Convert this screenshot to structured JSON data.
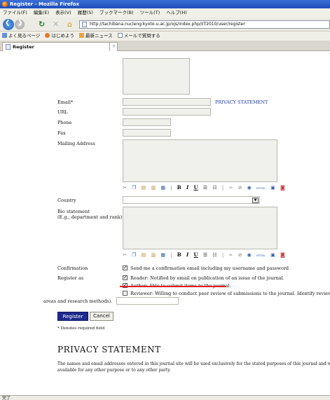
{
  "window": {
    "title": "Register - Mozilla Firefox"
  },
  "menubar": {
    "items": [
      "ファイル(F)",
      "編集(E)",
      "表示(V)",
      "履歴(S)",
      "ブックマーク(B)",
      "ツール(T)",
      "ヘルプ(H)"
    ]
  },
  "navbar": {
    "url": "http://tachibana.nucleng.kyoto-u.ac.jp/ojs/index.php/IIT2010/user/register"
  },
  "bookmarks": {
    "items": [
      "よく見るページ",
      "はじめよう",
      "最新ニュース",
      "メールで質問する"
    ]
  },
  "tabs": [
    {
      "label": "Register"
    }
  ],
  "form": {
    "email_label": "Email*",
    "privacy_link": "PRIVACY STATEMENT",
    "url_label": "URL",
    "phone_label": "Phone",
    "fax_label": "Fax",
    "mailing_label": "Mailing Address",
    "country_label": "Country",
    "bio_label_1": "Bio statement",
    "bio_label_2": "(E.g., department and rank)",
    "confirmation_label": "Confirmation",
    "confirmation_text": "Send me a confirmation email including my username and password",
    "register_as_label": "Register as",
    "reader_text": "Reader: Notified by email on publication of an issue of the journal.",
    "author_text": "Author: Able to submit items to the journal.",
    "reviewer_text": "Reviewer: Willing to conduct peer review of submissions to the journal. Identify reviewing in",
    "reviewer_text_2": "areas and research methods).",
    "register_button": "Register",
    "cancel_button": "Cancel",
    "required_note": "* Denotes required field"
  },
  "editor_toolbar": {
    "bold": "B",
    "italic": "I",
    "underline": "U",
    "html": "HTML"
  },
  "privacy": {
    "heading": "PRIVACY STATEMENT",
    "text": "The names and email addresses entered in this journal site will be used exclusively for the stated purposes of this journal and wi available for any other purpose or to any other party."
  },
  "statusbar": {
    "text": "完了"
  },
  "colors": {
    "titlebar": "#1f4fb9",
    "register_button": "#1f2a8c",
    "link": "#1b3b9a",
    "annotation_line": "#e01a1a"
  }
}
